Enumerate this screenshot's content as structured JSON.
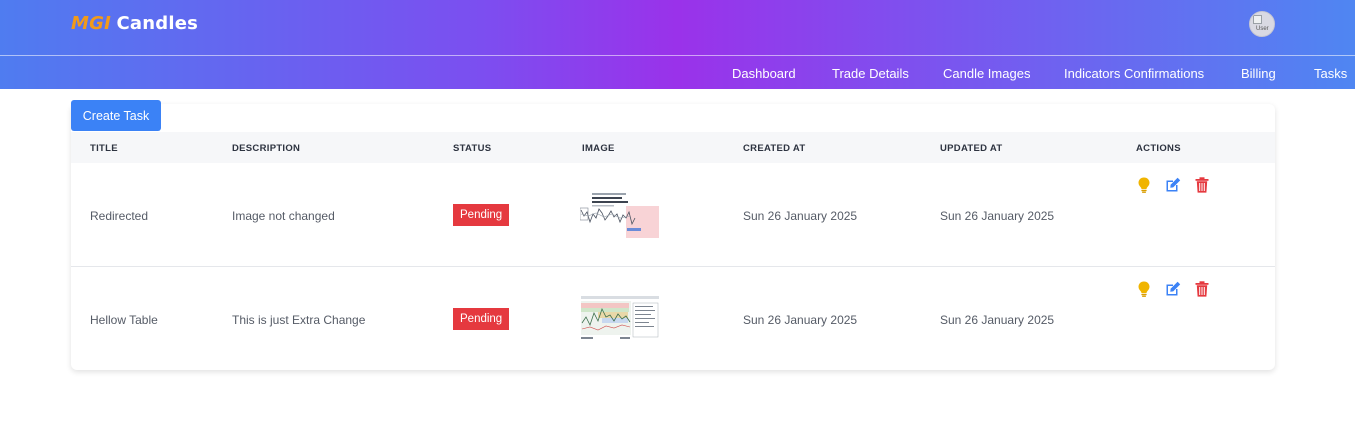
{
  "header": {
    "logo_brand": "MGI",
    "logo_name": "Candles",
    "avatar_alt": "User"
  },
  "nav": {
    "items": [
      {
        "label": "Dashboard"
      },
      {
        "label": "Trade Details"
      },
      {
        "label": "Candle Images"
      },
      {
        "label": "Indicators Confirmations"
      },
      {
        "label": "Billing"
      },
      {
        "label": "Tasks"
      }
    ]
  },
  "toolbar": {
    "create_label": "Create Task"
  },
  "table": {
    "columns": [
      "TITLE",
      "DESCRIPTION",
      "STATUS",
      "IMAGE",
      "CREATED AT",
      "UPDATED AT",
      "ACTIONS"
    ],
    "rows": [
      {
        "title": "Redirected",
        "description": "Image not changed",
        "status": "Pending",
        "created_at": "Sun 26 January 2025",
        "updated_at": "Sun 26 January 2025"
      },
      {
        "title": "Hellow Table",
        "description": "This is just Extra Change",
        "status": "Pending",
        "created_at": "Sun 26 January 2025",
        "updated_at": "Sun 26 January 2025"
      }
    ]
  },
  "colors": {
    "primary": "#3b82f6",
    "pending": "#e5393f",
    "idea_icon": "#f0b400",
    "edit_icon": "#3b82f6",
    "delete_icon": "#e5393f"
  },
  "icons": [
    "lightbulb-icon",
    "edit-icon",
    "trash-icon"
  ]
}
